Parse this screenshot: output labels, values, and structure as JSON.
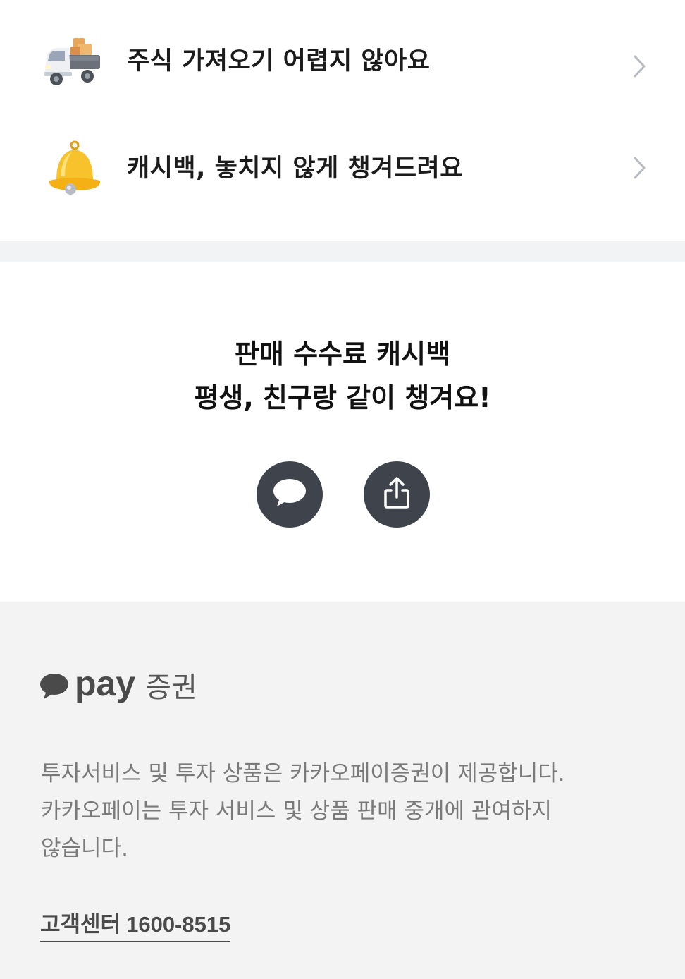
{
  "list": {
    "items": [
      {
        "label": "주식 가져오기 어렵지 않아요",
        "icon": "truck-icon"
      },
      {
        "label": "캐시백, 놓치지 않게 챙겨드려요",
        "icon": "bell-icon"
      }
    ]
  },
  "invite": {
    "line1": "판매 수수료 캐시백",
    "line2": "평생, 친구랑 같이 챙겨요!",
    "buttons": [
      {
        "icon": "speech-bubble-icon"
      },
      {
        "icon": "share-icon"
      }
    ]
  },
  "footer": {
    "brand": {
      "pay": "pay",
      "suffix": "증권"
    },
    "disclaimer": [
      "투자서비스 및 투자 상품은 카카오페이증권이 제공합니다.",
      "카카오페이는 투자 서비스 및 상품 판매 중개에 관여하지",
      "않습니다."
    ],
    "support": {
      "label": "고객센터",
      "number": "1600-8515"
    }
  },
  "colors": {
    "button_bg": "#3f444c",
    "band_bg": "#f2f3f5",
    "footer_bg": "#f3f3f4",
    "bell": "#f5b91e"
  }
}
